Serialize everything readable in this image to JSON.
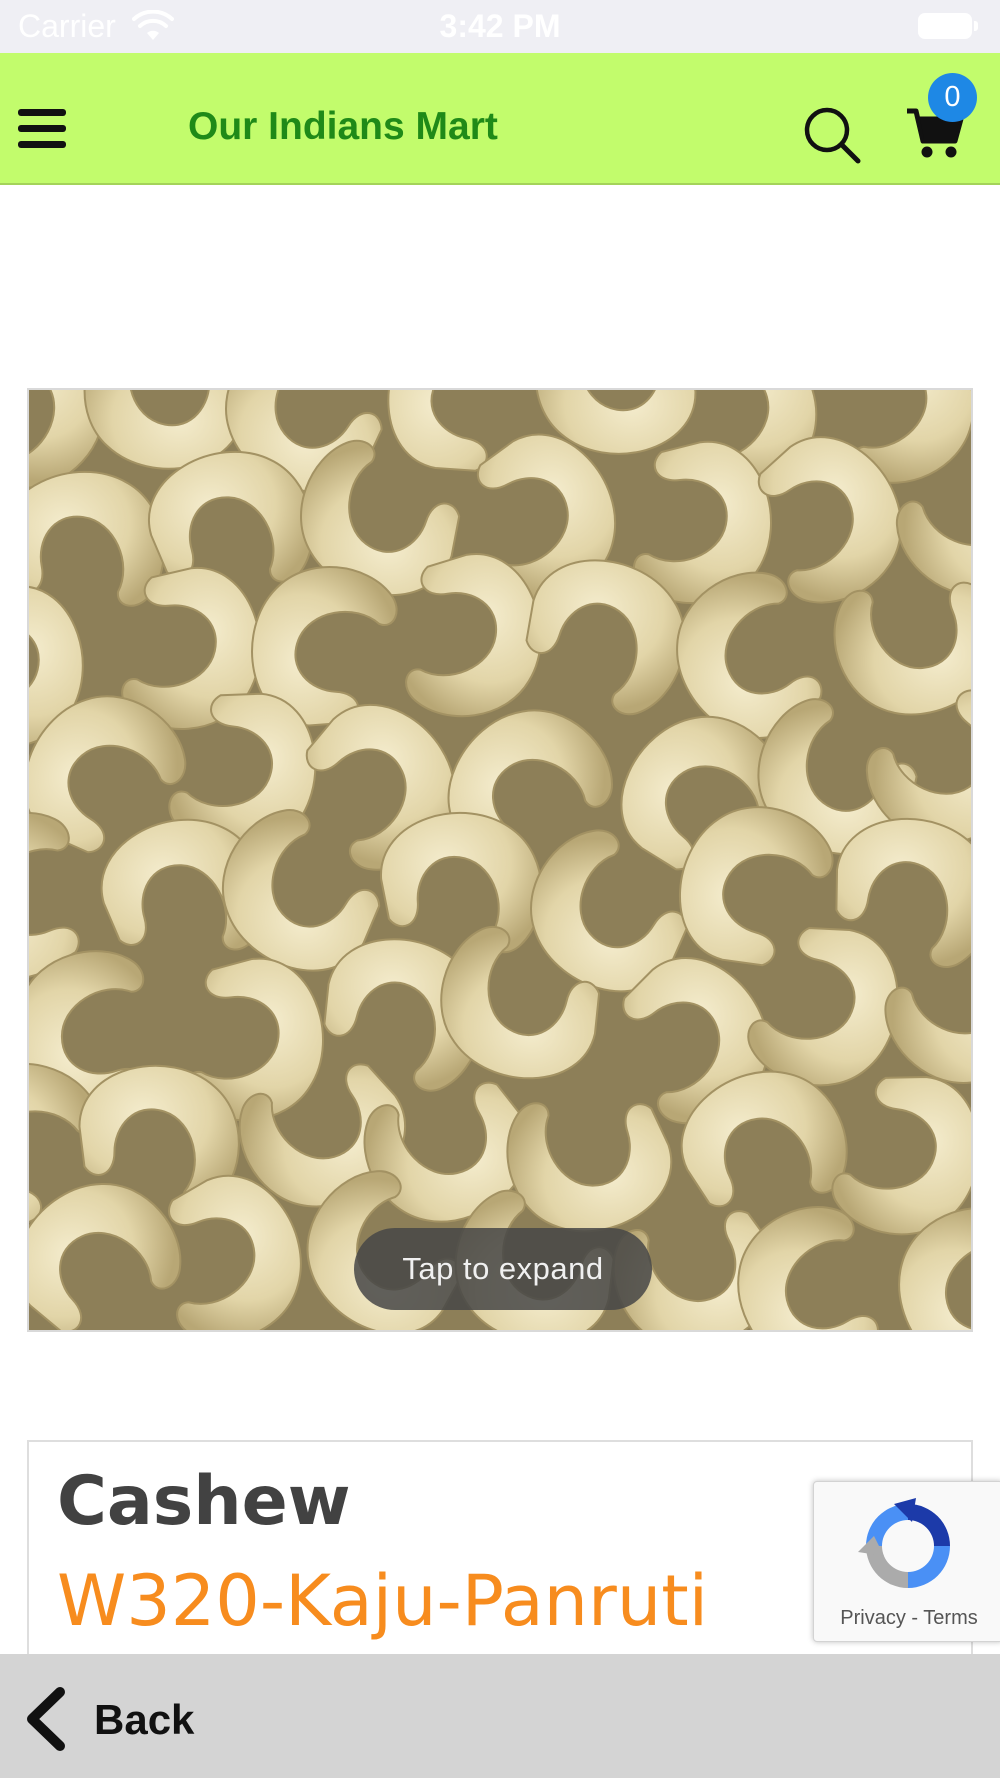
{
  "status_bar": {
    "carrier": "Carrier",
    "time": "3:42 PM"
  },
  "header": {
    "title": "Our Indians Mart",
    "cart_count": "0",
    "colors": {
      "background": "#c2fc6c",
      "title": "#1f8a18",
      "badge": "#1e88e5"
    },
    "icons": [
      "menu-icon",
      "search-icon",
      "cart-icon"
    ]
  },
  "product_image": {
    "overlay_label": "Tap to expand"
  },
  "product": {
    "name": "Cashew",
    "variant": "W320-Kaju-Panruti",
    "colors": {
      "name": "#424242",
      "variant": "#f78c1e"
    }
  },
  "recaptcha": {
    "privacy_label": "Privacy",
    "separator": "-",
    "terms_label": "Terms"
  },
  "bottom_bar": {
    "back_label": "Back",
    "icon": "chevron-left-icon"
  }
}
